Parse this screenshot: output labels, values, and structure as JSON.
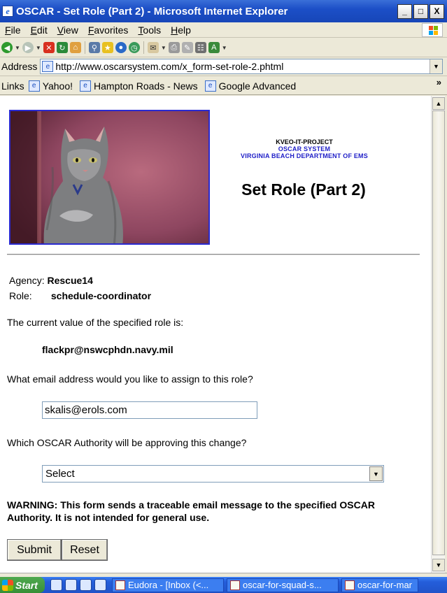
{
  "window": {
    "title": "OSCAR - Set Role (Part 2) - Microsoft Internet Explorer",
    "controls": [
      "_",
      "□",
      "X"
    ]
  },
  "menu": [
    "File",
    "Edit",
    "View",
    "Favorites",
    "Tools",
    "Help"
  ],
  "address": {
    "label": "Address",
    "url": "http://www.oscarsystem.com/x_form-set-role-2.phtml"
  },
  "links": {
    "label": "Links",
    "items": [
      "Yahoo!",
      "Hampton Roads - News",
      "Google Advanced"
    ]
  },
  "page": {
    "project": "KVEO-IT-PROJECT",
    "system": "OSCAR SYSTEM",
    "department": "VIRGINIA BEACH DEPARTMENT OF EMS",
    "title": "Set Role (Part 2)",
    "agency_label": "Agency:",
    "agency_value": "Rescue14",
    "role_label": "Role:",
    "role_value": "schedule-coordinator",
    "current_value_text": "The current value of the specified role is:",
    "current_value": "flackpr@nswcphdn.navy.mil",
    "email_question": "What email address would you like to assign to this role?",
    "email_value": "skalis@erols.com",
    "authority_question": "Which OSCAR Authority will be approving this change?",
    "authority_selected": "Select",
    "warning": "WARNING:  This form sends a traceable email message to the specified OSCAR Authority.  It is not intended for general use.",
    "submit_label": "Submit",
    "reset_label": "Reset"
  },
  "taskbar": {
    "start_label": "Start",
    "tasks": [
      "Eudora - [Inbox (<...",
      "oscar-for-squad-s...",
      "oscar-for-mar"
    ]
  }
}
